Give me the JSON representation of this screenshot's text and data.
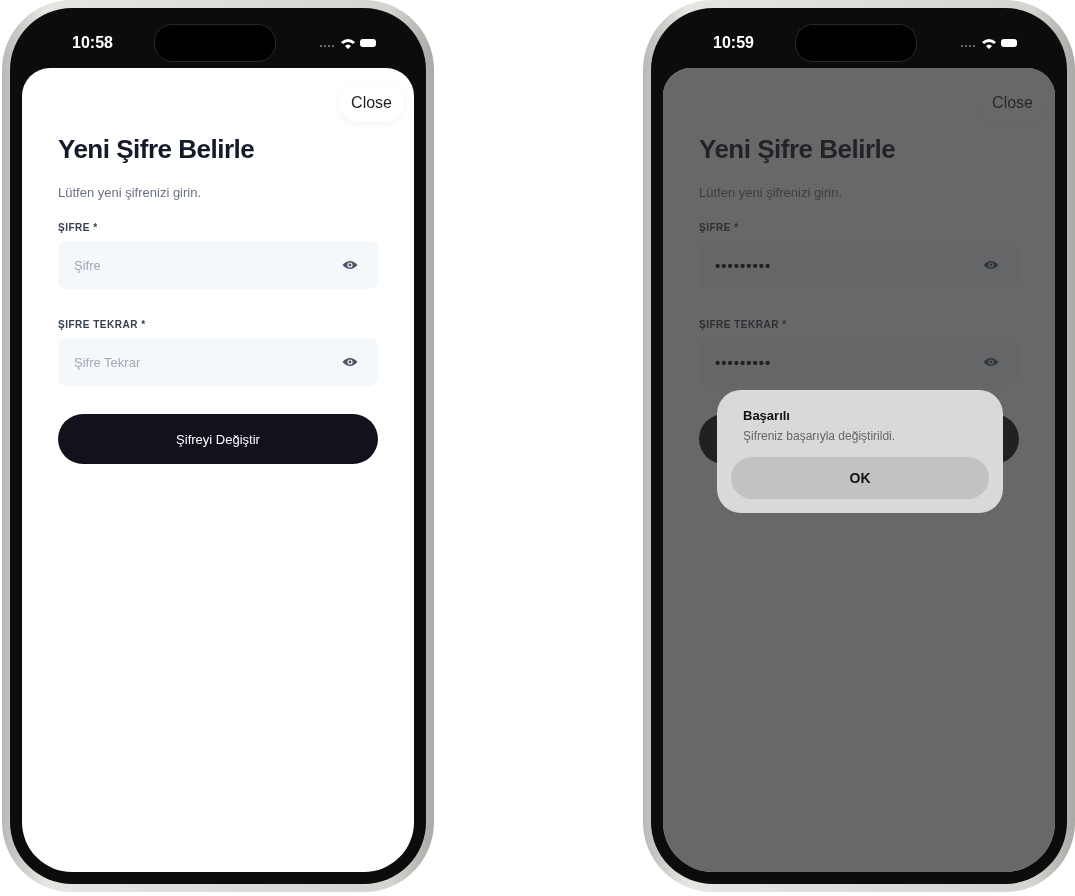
{
  "phones": [
    {
      "status_time": "10:58",
      "close_label": "Close",
      "title": "Yeni Şifre Belirle",
      "subtitle": "Lütfen yeni şifrenizi girin.",
      "fields": [
        {
          "label": "ŞIFRE *",
          "placeholder": "Şifre"
        },
        {
          "label": "ŞIFRE TEKRAR *",
          "placeholder": "Şifre Tekrar"
        }
      ],
      "submit_label": "Şifreyi Değiştir"
    },
    {
      "status_time": "10:59",
      "close_label": "Close",
      "title": "Yeni Şifre Belirle",
      "subtitle": "Lütfen yeni şifrenizi girin.",
      "fields": [
        {
          "label": "ŞIFRE *",
          "value": "•••••••••"
        },
        {
          "label": "ŞIFRE TEKRAR *",
          "value": "•••••••••"
        }
      ],
      "alert": {
        "title": "Başarılı",
        "message": "Şifreniz başarıyla değiştirildi.",
        "button": "OK"
      }
    }
  ]
}
